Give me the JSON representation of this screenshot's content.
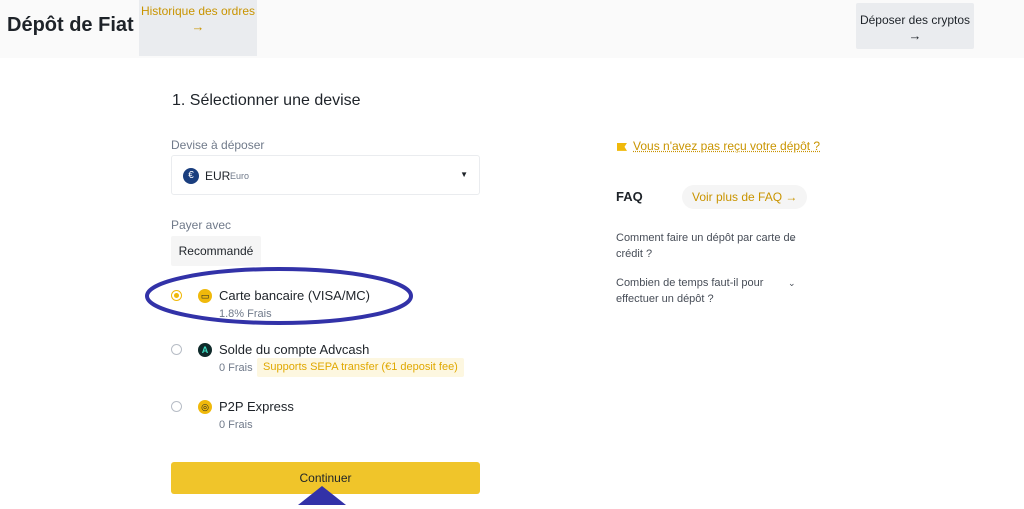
{
  "header": {
    "title": "Dépôt de Fiat",
    "history_button": {
      "label": "Historique des ordres",
      "arrow": "→"
    },
    "crypto_button": {
      "label": "Déposer des cryptos",
      "arrow": "→"
    }
  },
  "step": {
    "title": "1. Sélectionner une devise"
  },
  "currency": {
    "label": "Devise à déposer",
    "selected_code": "EUR",
    "selected_name": "Euro",
    "coin_symbol": "€",
    "caret": "▼"
  },
  "payment": {
    "label": "Payer avec",
    "tab_label": "Recommandé",
    "methods": [
      {
        "name": "Carte bancaire (VISA/MC)",
        "fee": "1.8% Frais",
        "selected": true,
        "icon": "card-icon",
        "icon_glyph": "▭"
      },
      {
        "name": "Solde du compte Advcash",
        "fee": "0 Frais",
        "badge": "Supports SEPA transfer (€1 deposit fee)",
        "selected": false,
        "icon": "advcash-icon",
        "icon_glyph": "A"
      },
      {
        "name": "P2P Express",
        "fee": "0 Frais",
        "selected": false,
        "icon": "p2p-icon",
        "icon_glyph": "◎"
      }
    ]
  },
  "continue_button": {
    "label": "Continuer"
  },
  "help": {
    "not_received_link": "Vous n'avez pas reçu votre dépôt ?"
  },
  "faq": {
    "title": "FAQ",
    "more_label": "Voir plus de FAQ →",
    "items": [
      {
        "question": "Comment faire un dépôt par carte de crédit ?"
      },
      {
        "question": "Combien de temps faut-il pour effectuer un dépôt ?"
      }
    ],
    "chevron": "⌄"
  },
  "colors": {
    "accent": "#f0b90b",
    "link": "#c99400",
    "annotation": "#3232a8"
  }
}
